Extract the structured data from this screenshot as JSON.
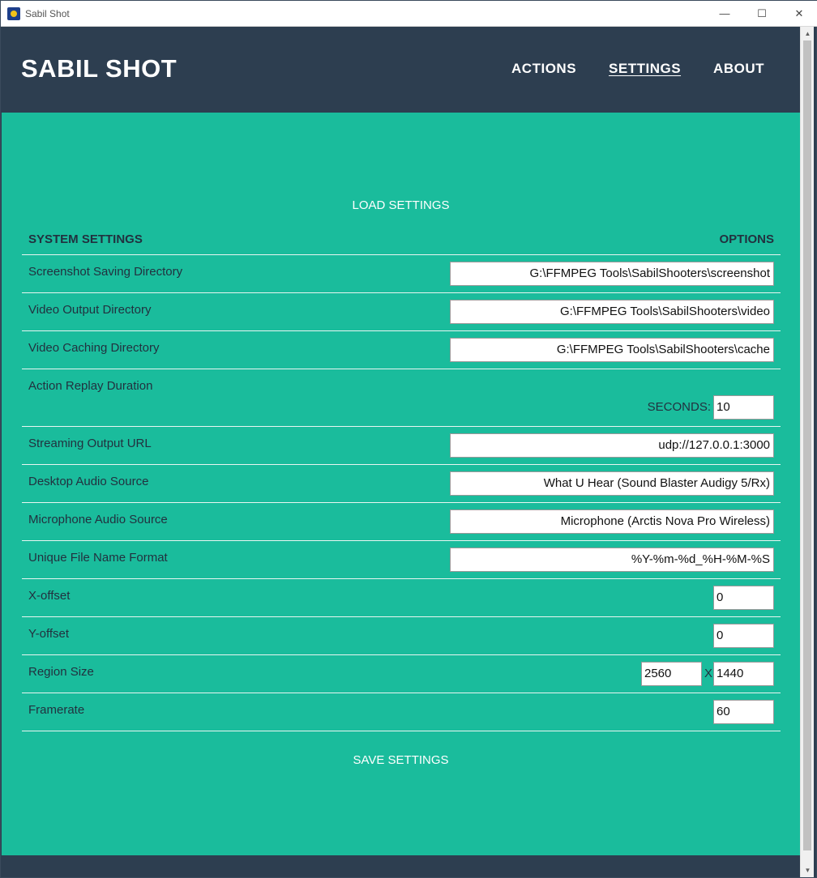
{
  "window": {
    "title": "Sabil Shot"
  },
  "header": {
    "brand": "SABIL SHOT",
    "nav": [
      {
        "label": "ACTIONS",
        "active": false
      },
      {
        "label": "SETTINGS",
        "active": true
      },
      {
        "label": "ABOUT",
        "active": false
      }
    ]
  },
  "buttons": {
    "load": "LOAD SETTINGS",
    "save": "SAVE SETTINGS"
  },
  "table": {
    "col_settings": "SYSTEM SETTINGS",
    "col_options": "OPTIONS"
  },
  "settings": {
    "screenshot_dir": {
      "label": "Screenshot Saving Directory",
      "value": "G:\\FFMPEG Tools\\SabilShooters\\screenshot"
    },
    "video_out_dir": {
      "label": "Video Output Directory",
      "value": "G:\\FFMPEG Tools\\SabilShooters\\video"
    },
    "video_cache_dir": {
      "label": "Video Caching Directory",
      "value": "G:\\FFMPEG Tools\\SabilShooters\\cache"
    },
    "replay": {
      "label": "Action Replay Duration",
      "unit_label": "SECONDS:",
      "value": "10"
    },
    "stream_url": {
      "label": "Streaming Output URL",
      "value": "udp://127.0.0.1:3000"
    },
    "desktop_audio": {
      "label": "Desktop Audio Source",
      "value": "What U Hear (Sound Blaster Audigy 5/Rx)"
    },
    "mic_audio": {
      "label": "Microphone Audio Source",
      "value": "Microphone (Arctis Nova Pro Wireless)"
    },
    "file_format": {
      "label": "Unique File Name Format",
      "value": "%Y-%m-%d_%H-%M-%S"
    },
    "x_offset": {
      "label": "X-offset",
      "value": "0"
    },
    "y_offset": {
      "label": "Y-offset",
      "value": "0"
    },
    "region": {
      "label": "Region Size",
      "width": "2560",
      "separator": "X",
      "height": "1440"
    },
    "framerate": {
      "label": "Framerate",
      "value": "60"
    }
  },
  "colors": {
    "header_bg": "#2d3e50",
    "main_bg": "#1abc9c",
    "text_dark": "#22313f",
    "text_light": "#ffffff"
  }
}
